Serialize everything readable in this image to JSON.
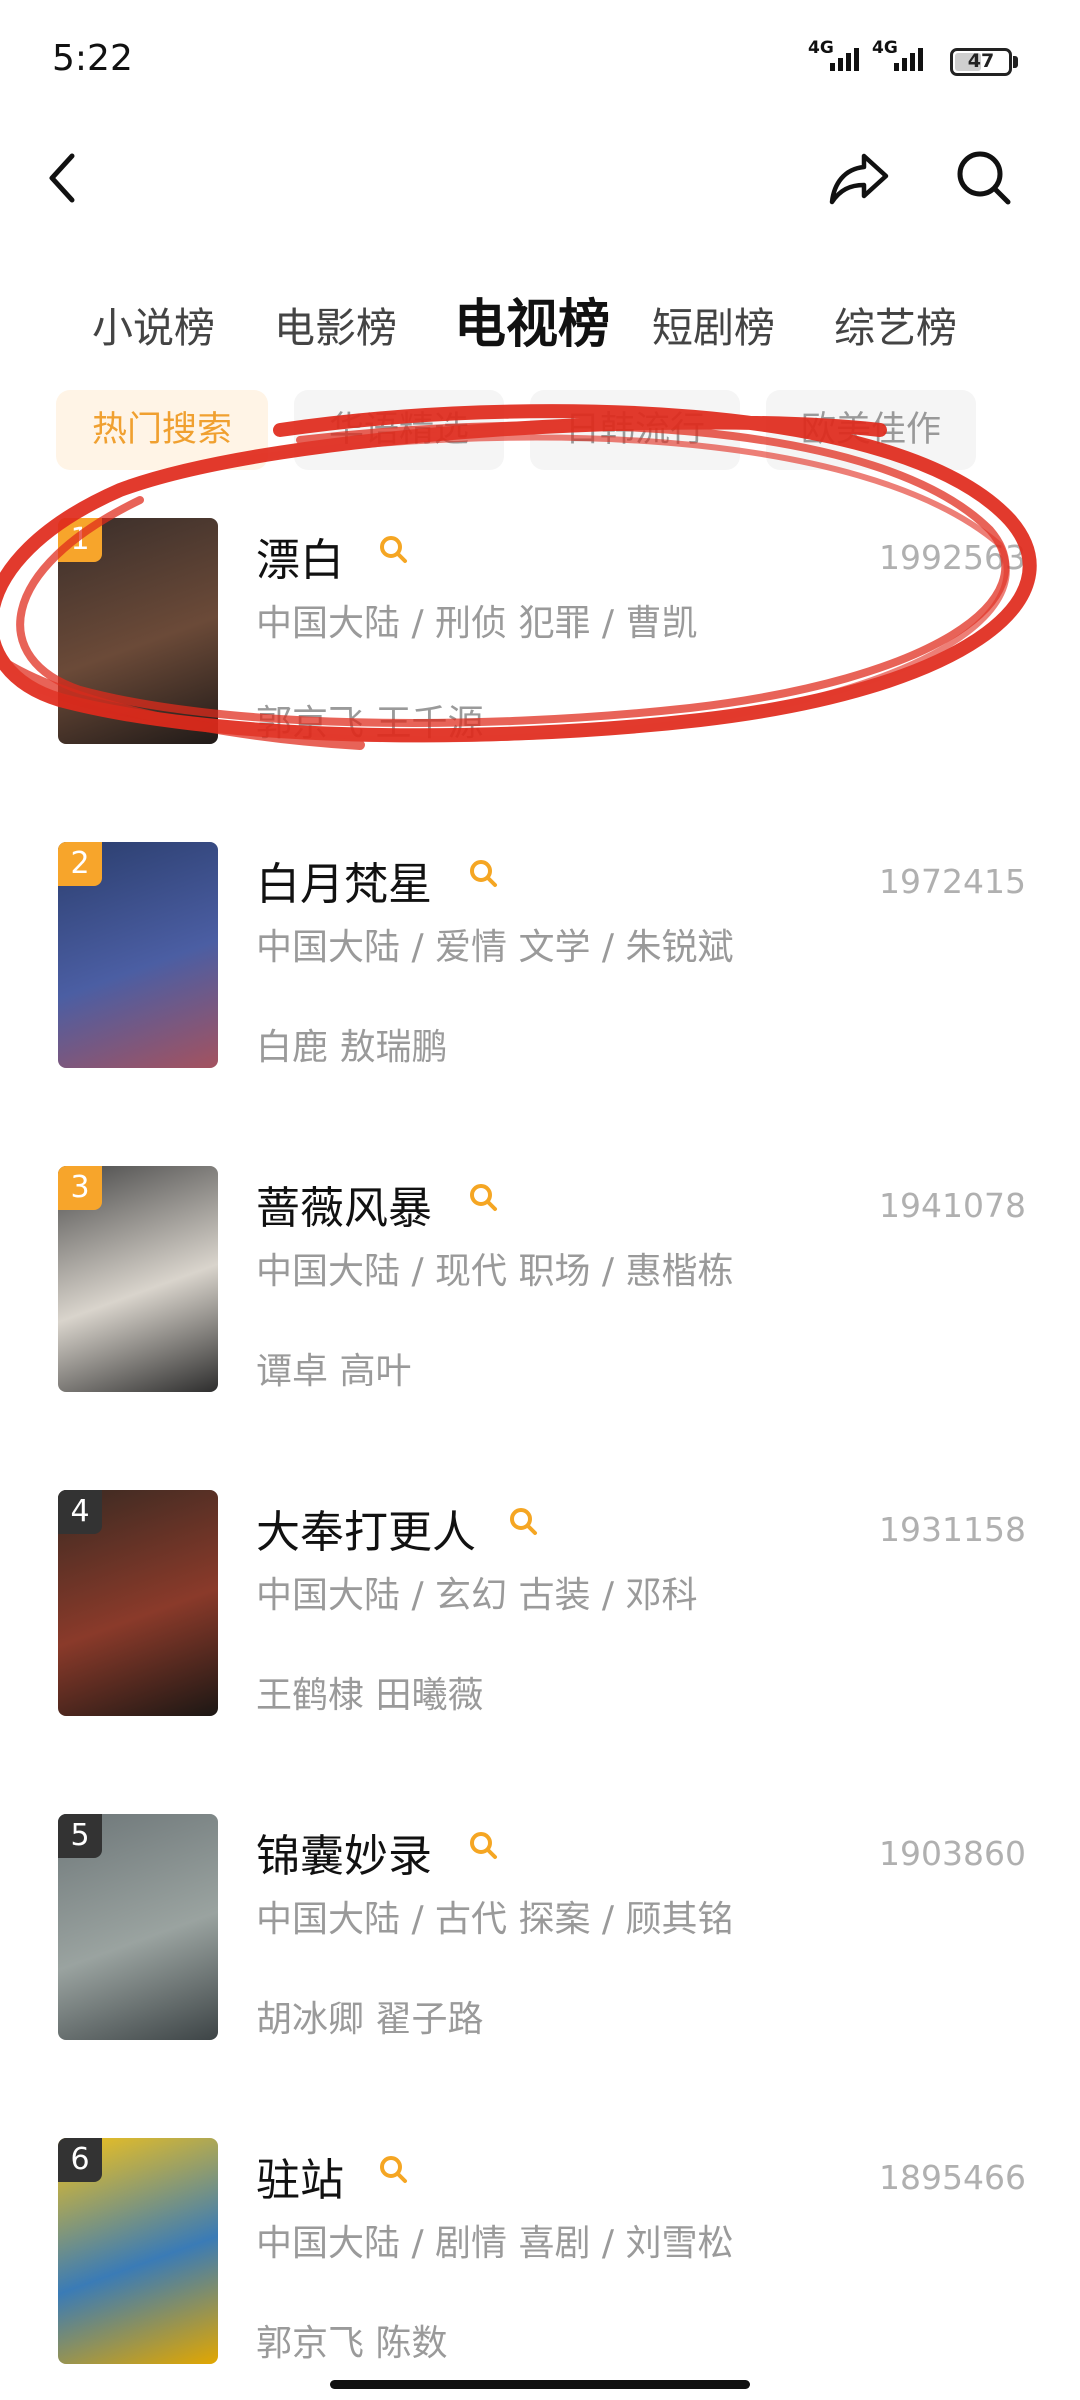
{
  "status_bar": {
    "time": "5:22",
    "network_1": "4G",
    "network_2": "4G",
    "battery": "47"
  },
  "header": {
    "back_icon": "chevron-left-icon",
    "share_icon": "share-icon",
    "search_icon": "search-icon"
  },
  "category_tabs": [
    {
      "label": "小说榜"
    },
    {
      "label": "电影榜"
    },
    {
      "label": "电视榜",
      "active": true
    },
    {
      "label": "短剧榜"
    },
    {
      "label": "综艺榜"
    }
  ],
  "filter_chips": [
    {
      "label": "热门搜索",
      "active": true
    },
    {
      "label": "华语精选"
    },
    {
      "label": "日韩流行"
    },
    {
      "label": "欧美佳作"
    }
  ],
  "list": [
    {
      "rank": "1",
      "title": "漂白",
      "score": "1992563",
      "meta": "中国大陆 / 刑侦 犯罪 / 曹凯",
      "cast": "郭京飞 王千源",
      "rank_color": "#f7a52b",
      "poster_colors": [
        "#3a2e2a",
        "#6b4a38",
        "#201a18"
      ]
    },
    {
      "rank": "2",
      "title": "白月梵星",
      "score": "1972415",
      "meta": "中国大陆 / 爱情 文学 / 朱锐斌",
      "cast": "白鹿 敖瑞鹏",
      "rank_color": "#f7a52b",
      "poster_colors": [
        "#2b3e6e",
        "#4b5ea3",
        "#a4525f"
      ]
    },
    {
      "rank": "3",
      "title": "蔷薇风暴",
      "score": "1941078",
      "meta": "中国大陆 / 现代 职场 / 惠楷栋",
      "cast": "谭卓 高叶",
      "rank_color": "#f7a52b",
      "poster_colors": [
        "#4a4a4a",
        "#d9d4cc",
        "#2d2d2d"
      ]
    },
    {
      "rank": "4",
      "title": "大奉打更人",
      "score": "1931158",
      "meta": "中国大陆 / 玄幻 古装 / 邓科",
      "cast": "王鹤棣 田曦薇",
      "rank_color": "#333333",
      "poster_colors": [
        "#3b2a22",
        "#8a3a2a",
        "#1c1714"
      ]
    },
    {
      "rank": "5",
      "title": "锦囊妙录",
      "score": "1903860",
      "meta": "中国大陆 / 古代 探案 / 顾其铭",
      "cast": "胡冰卿 翟子路",
      "rank_color": "#333333",
      "poster_colors": [
        "#6e7779",
        "#9aa3a0",
        "#3d4446"
      ]
    },
    {
      "rank": "6",
      "title": "驻站",
      "score": "1895466",
      "meta": "中国大陆 / 剧情 喜剧 / 刘雪松",
      "cast": "郭京飞 陈数",
      "rank_color": "#333333",
      "poster_colors": [
        "#f2c21b",
        "#3a7bb6",
        "#e2a700"
      ]
    }
  ]
}
